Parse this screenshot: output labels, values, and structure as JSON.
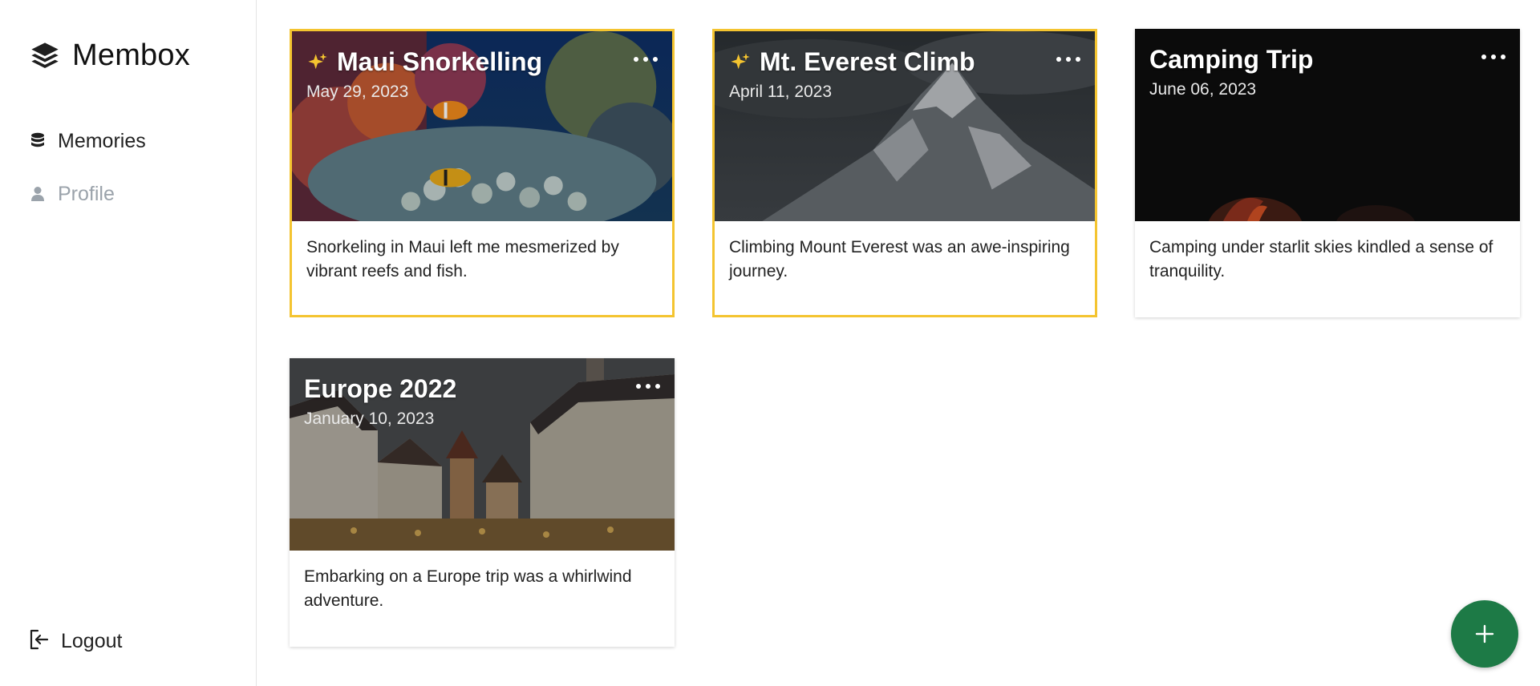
{
  "app": {
    "name": "Membox"
  },
  "sidebar": {
    "items": [
      {
        "label": "Memories",
        "icon": "database-icon",
        "active": true
      },
      {
        "label": "Profile",
        "icon": "user-icon",
        "active": false
      }
    ],
    "logout_label": "Logout"
  },
  "memories": [
    {
      "title": "Maui Snorkelling",
      "date": "May 29, 2023",
      "description": "Snorkeling in Maui left me mesmerized by vibrant reefs and fish.",
      "featured": true,
      "image": "coral-reef"
    },
    {
      "title": "Mt. Everest Climb",
      "date": "April 11, 2023",
      "description": "Climbing Mount Everest was an awe-inspiring journey.",
      "featured": true,
      "image": "mountain"
    },
    {
      "title": "Camping Trip",
      "date": "June 06, 2023",
      "description": "Camping under starlit skies kindled a sense of tranquility.",
      "featured": false,
      "image": "campfire"
    },
    {
      "title": "Europe 2022",
      "date": "January 10, 2023",
      "description": "Embarking on a Europe trip was a whirlwind adventure.",
      "featured": false,
      "image": "european-town"
    }
  ],
  "colors": {
    "featured_border": "#f4c430",
    "fab": "#1d7a46",
    "inactive_nav": "#9ba3ab"
  }
}
